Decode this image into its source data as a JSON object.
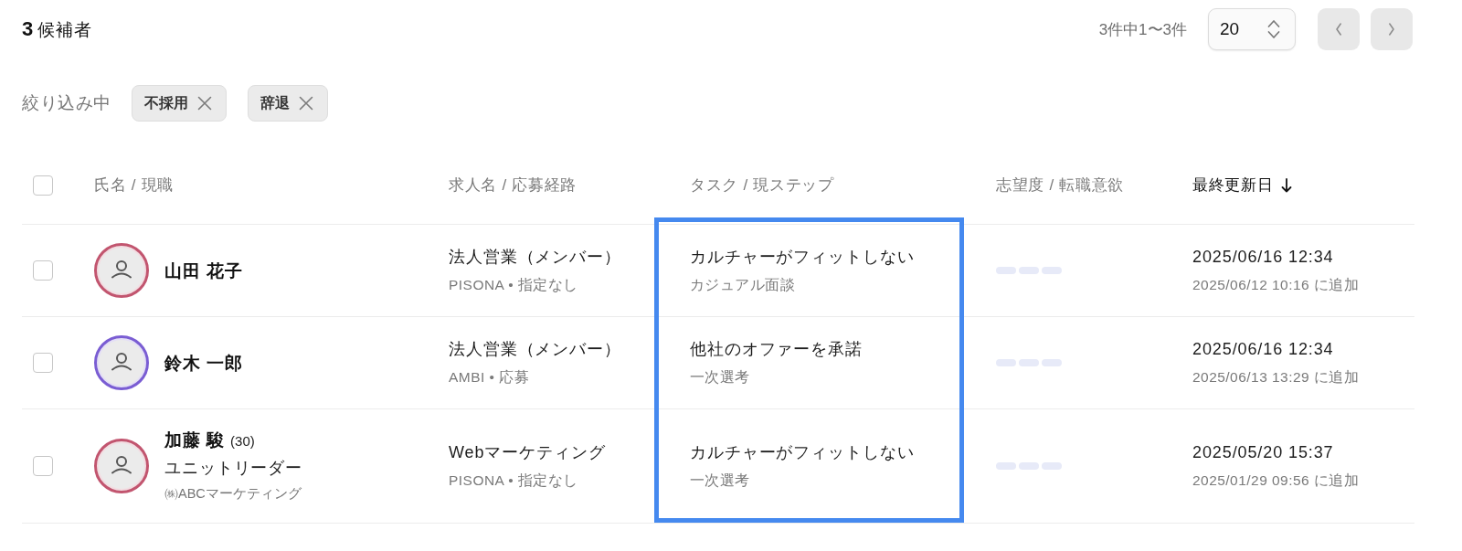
{
  "header": {
    "count": "3",
    "title": "候補者"
  },
  "pagination": {
    "summary": "3件中1〜3件",
    "page_size": "20",
    "prev": {
      "disabled": true
    },
    "next": {
      "disabled": true
    }
  },
  "filters": {
    "label": "絞り込み中",
    "chips": [
      {
        "label": "不採用"
      },
      {
        "label": "辞退"
      }
    ]
  },
  "table": {
    "select_all": {
      "checked": false
    },
    "columns": [
      {
        "label": "氏名 / 現職",
        "sorted": false,
        "highlighted": false
      },
      {
        "label": "求人名 / 応募経路",
        "sorted": false,
        "highlighted": false
      },
      {
        "label": "タスク / 現ステップ",
        "sorted": false,
        "highlighted": true
      },
      {
        "label": "志望度 / 転職意欲",
        "sorted": false,
        "highlighted": false
      },
      {
        "label": "最終更新日",
        "sorted": true,
        "highlighted": false
      }
    ],
    "rows": [
      {
        "checked": false,
        "color": "#c2556f",
        "name": "山田 花子",
        "job": "法人営業（メンバー）",
        "source": "PISONA • 指定なし",
        "task": "カルチャーがフィットしない",
        "step": "カジュアル面談",
        "aspiration": {
          "loading": true
        },
        "updated": "2025/06/16 12:34",
        "added": "2025/06/12 10:16 に追加"
      },
      {
        "checked": false,
        "color": "#7a5dd3",
        "name": "鈴木 一郎",
        "job": "法人営業（メンバー）",
        "source": "AMBI • 応募",
        "task": "他社のオファーを承諾",
        "step": "一次選考",
        "aspiration": {
          "loading": true
        },
        "updated": "2025/06/16 12:34",
        "added": "2025/06/13 13:29 に追加"
      },
      {
        "checked": false,
        "color": "#c2556f",
        "name": "加藤 駿",
        "age": "(30)",
        "position": "ユニットリーダー",
        "company": "㈱ABCマーケティング",
        "job": "Webマーケティング",
        "source": "PISONA • 指定なし",
        "task": "カルチャーがフィットしない",
        "step": "一次選考",
        "aspiration": {
          "loading": true
        },
        "updated": "2025/05/20 15:37",
        "added": "2025/01/29 09:56 に追加"
      }
    ]
  }
}
